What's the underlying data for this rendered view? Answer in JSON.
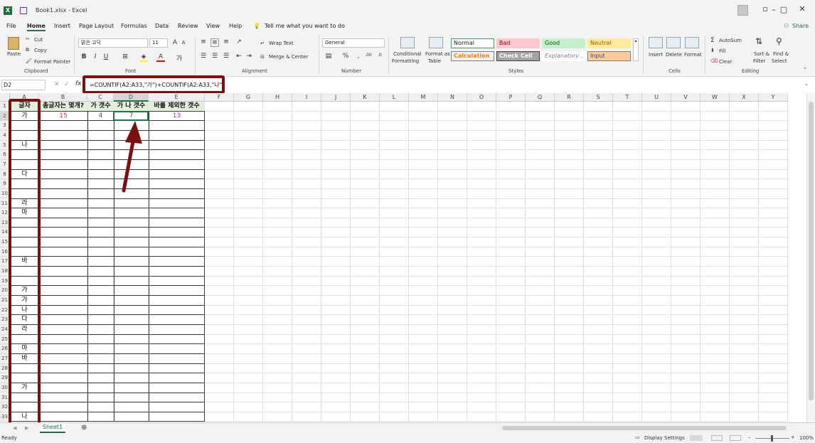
{
  "titlebar": {
    "title": "Book1.xlsx  -  Excel"
  },
  "tabs": [
    "File",
    "Home",
    "Insert",
    "Page Layout",
    "Formulas",
    "Data",
    "Review",
    "View",
    "Help"
  ],
  "tell_me": "Tell me what you want to do",
  "share": "Share",
  "clipboard": {
    "paste": "Paste",
    "cut": "Cut",
    "copy": "Copy",
    "format_painter": "Format Painter",
    "group": "Clipboard"
  },
  "font": {
    "name": "맑은 고딕",
    "size": "11",
    "group": "Font"
  },
  "alignment": {
    "wrap_text": "Wrap Text",
    "merge_center": "Merge & Center",
    "group": "Alignment"
  },
  "number": {
    "format": "General",
    "group": "Number"
  },
  "styles": {
    "conditional_formatting_1": "Conditional",
    "conditional_formatting_2": "Formatting",
    "format_as_table_1": "Format as",
    "format_as_table_2": "Table",
    "group": "Styles",
    "cells": [
      {
        "label": "Normal",
        "bg": "#ffffff",
        "fg": "#222222",
        "border": "#4a9a6e"
      },
      {
        "label": "Bad",
        "bg": "#ffc7ce",
        "fg": "#9c0006",
        "border": "#ffc7ce"
      },
      {
        "label": "Good",
        "bg": "#c6efce",
        "fg": "#006100",
        "border": "#c6efce"
      },
      {
        "label": "Neutral",
        "bg": "#ffeb9c",
        "fg": "#9c5700",
        "border": "#ffeb9c"
      },
      {
        "label": "Calculation",
        "bg": "#f2f2f2",
        "fg": "#fa7d00",
        "border": "#7f7f7f"
      },
      {
        "label": "Check Cell",
        "bg": "#a5a5a5",
        "fg": "#ffffff",
        "border": "#3f3f3f"
      },
      {
        "label": "Explanatory ...",
        "bg": "#ffffff",
        "fg": "#7f7f7f",
        "border": "#ffffff"
      },
      {
        "label": "Input",
        "bg": "#ffcc99",
        "fg": "#3f3f76",
        "border": "#7f7f7f"
      }
    ]
  },
  "cells_group": {
    "insert": "Insert",
    "delete": "Delete",
    "format": "Format",
    "group": "Cells"
  },
  "editing": {
    "autosum": "AutoSum",
    "fill": "Fill",
    "clear": "Clear",
    "sort_filter_1": "Sort &",
    "sort_filter_2": "Filter",
    "find_select_1": "Find &",
    "find_select_2": "Select",
    "group": "Editing"
  },
  "formula_bar": {
    "name_box": "D2",
    "fx": "fx",
    "formula": "=COUNTIF(A2:A33,\"가\")+COUNTIF(A2:A33,\"나\")"
  },
  "columns": [
    "A",
    "B",
    "C",
    "D",
    "E",
    "F",
    "G",
    "H",
    "I",
    "J",
    "K",
    "L",
    "M",
    "N",
    "O",
    "P",
    "Q",
    "R",
    "S",
    "T",
    "U",
    "V",
    "W",
    "X",
    "Y"
  ],
  "rows": [
    "1",
    "2",
    "3",
    "4",
    "5",
    "6",
    "7",
    "8",
    "9",
    "10",
    "11",
    "12",
    "13",
    "14",
    "15",
    "16",
    "17",
    "18",
    "19",
    "20",
    "21",
    "22",
    "23",
    "24",
    "25",
    "26",
    "27",
    "28",
    "29",
    "30",
    "31",
    "32",
    "33"
  ],
  "headers": {
    "a1": "글자",
    "b1": "총글자는 몇개?",
    "c1": "가 갯수",
    "d1": "가 나 갯수",
    "e1": "바를 제외한 갯수"
  },
  "values": {
    "b2": "15",
    "c2": "4",
    "d2": "7",
    "e2": "13"
  },
  "column_a": [
    {
      "row": 2,
      "text": "가"
    },
    {
      "row": 5,
      "text": "나"
    },
    {
      "row": 8,
      "text": "다"
    },
    {
      "row": 11,
      "text": "라"
    },
    {
      "row": 12,
      "text": "마"
    },
    {
      "row": 17,
      "text": "바"
    },
    {
      "row": 20,
      "text": "가"
    },
    {
      "row": 21,
      "text": "가"
    },
    {
      "row": 22,
      "text": "나"
    },
    {
      "row": 23,
      "text": "다"
    },
    {
      "row": 24,
      "text": "라"
    },
    {
      "row": 26,
      "text": "마"
    },
    {
      "row": 27,
      "text": "바"
    },
    {
      "row": 30,
      "text": "가"
    },
    {
      "row": 33,
      "text": "나"
    }
  ],
  "sheet_tab": "Sheet1",
  "status": {
    "ready": "Ready",
    "display_settings": "Display Settings",
    "zoom": "100%"
  },
  "colors": {
    "accent": "#217346",
    "annotation": "#7b1010",
    "b2": "#e03030",
    "c2": "#2f55c7",
    "d2": "#2a7a2a",
    "e2": "#9b30b0"
  }
}
